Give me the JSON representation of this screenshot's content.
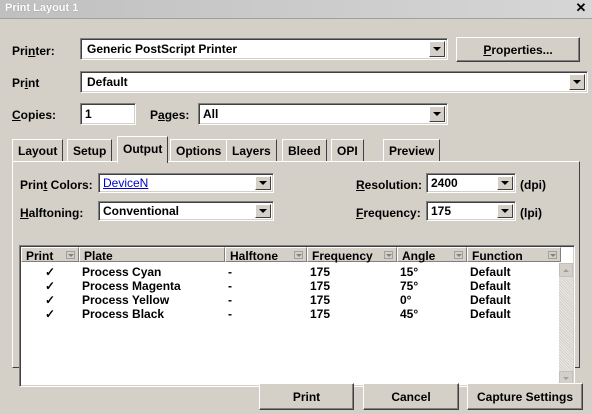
{
  "window": {
    "title": "Print Layout 1"
  },
  "printer": {
    "label": "Printer:",
    "value": "Generic PostScript Printer",
    "properties_label": "Properties..."
  },
  "print": {
    "label": "Print",
    "value": "Default"
  },
  "copies": {
    "label": "Copies:",
    "value": "1"
  },
  "pages": {
    "label": "Pages:",
    "value": "All"
  },
  "tabs": [
    "Layout",
    "Setup",
    "Output",
    "Options",
    "Layers",
    "Bleed",
    "OPI",
    "Preview"
  ],
  "active_tab": "Output",
  "output": {
    "print_colors_label": "Print Colors:",
    "print_colors_value": "DeviceN",
    "halftoning_label": "Halftoning:",
    "halftoning_value": "Conventional",
    "resolution_label": "Resolution:",
    "resolution_value": "2400",
    "resolution_unit": "(dpi)",
    "frequency_label": "Frequency:",
    "frequency_value": "175",
    "frequency_unit": "(lpi)"
  },
  "table": {
    "columns": [
      "Print",
      "Plate",
      "Halftone",
      "Frequency",
      "Angle",
      "Function"
    ],
    "rows": [
      {
        "print": "✓",
        "plate": "Process Cyan",
        "halftone": "-",
        "frequency": "175",
        "angle": "15°",
        "function": "Default"
      },
      {
        "print": "✓",
        "plate": "Process Magenta",
        "halftone": "-",
        "frequency": "175",
        "angle": "75°",
        "function": "Default"
      },
      {
        "print": "✓",
        "plate": "Process Yellow",
        "halftone": "-",
        "frequency": "175",
        "angle": "0°",
        "function": "Default"
      },
      {
        "print": "✓",
        "plate": "Process Black",
        "halftone": "-",
        "frequency": "175",
        "angle": "45°",
        "function": "Default"
      }
    ]
  },
  "footer": {
    "print_label": "Print",
    "cancel_label": "Cancel",
    "capture_label": "Capture Settings"
  }
}
